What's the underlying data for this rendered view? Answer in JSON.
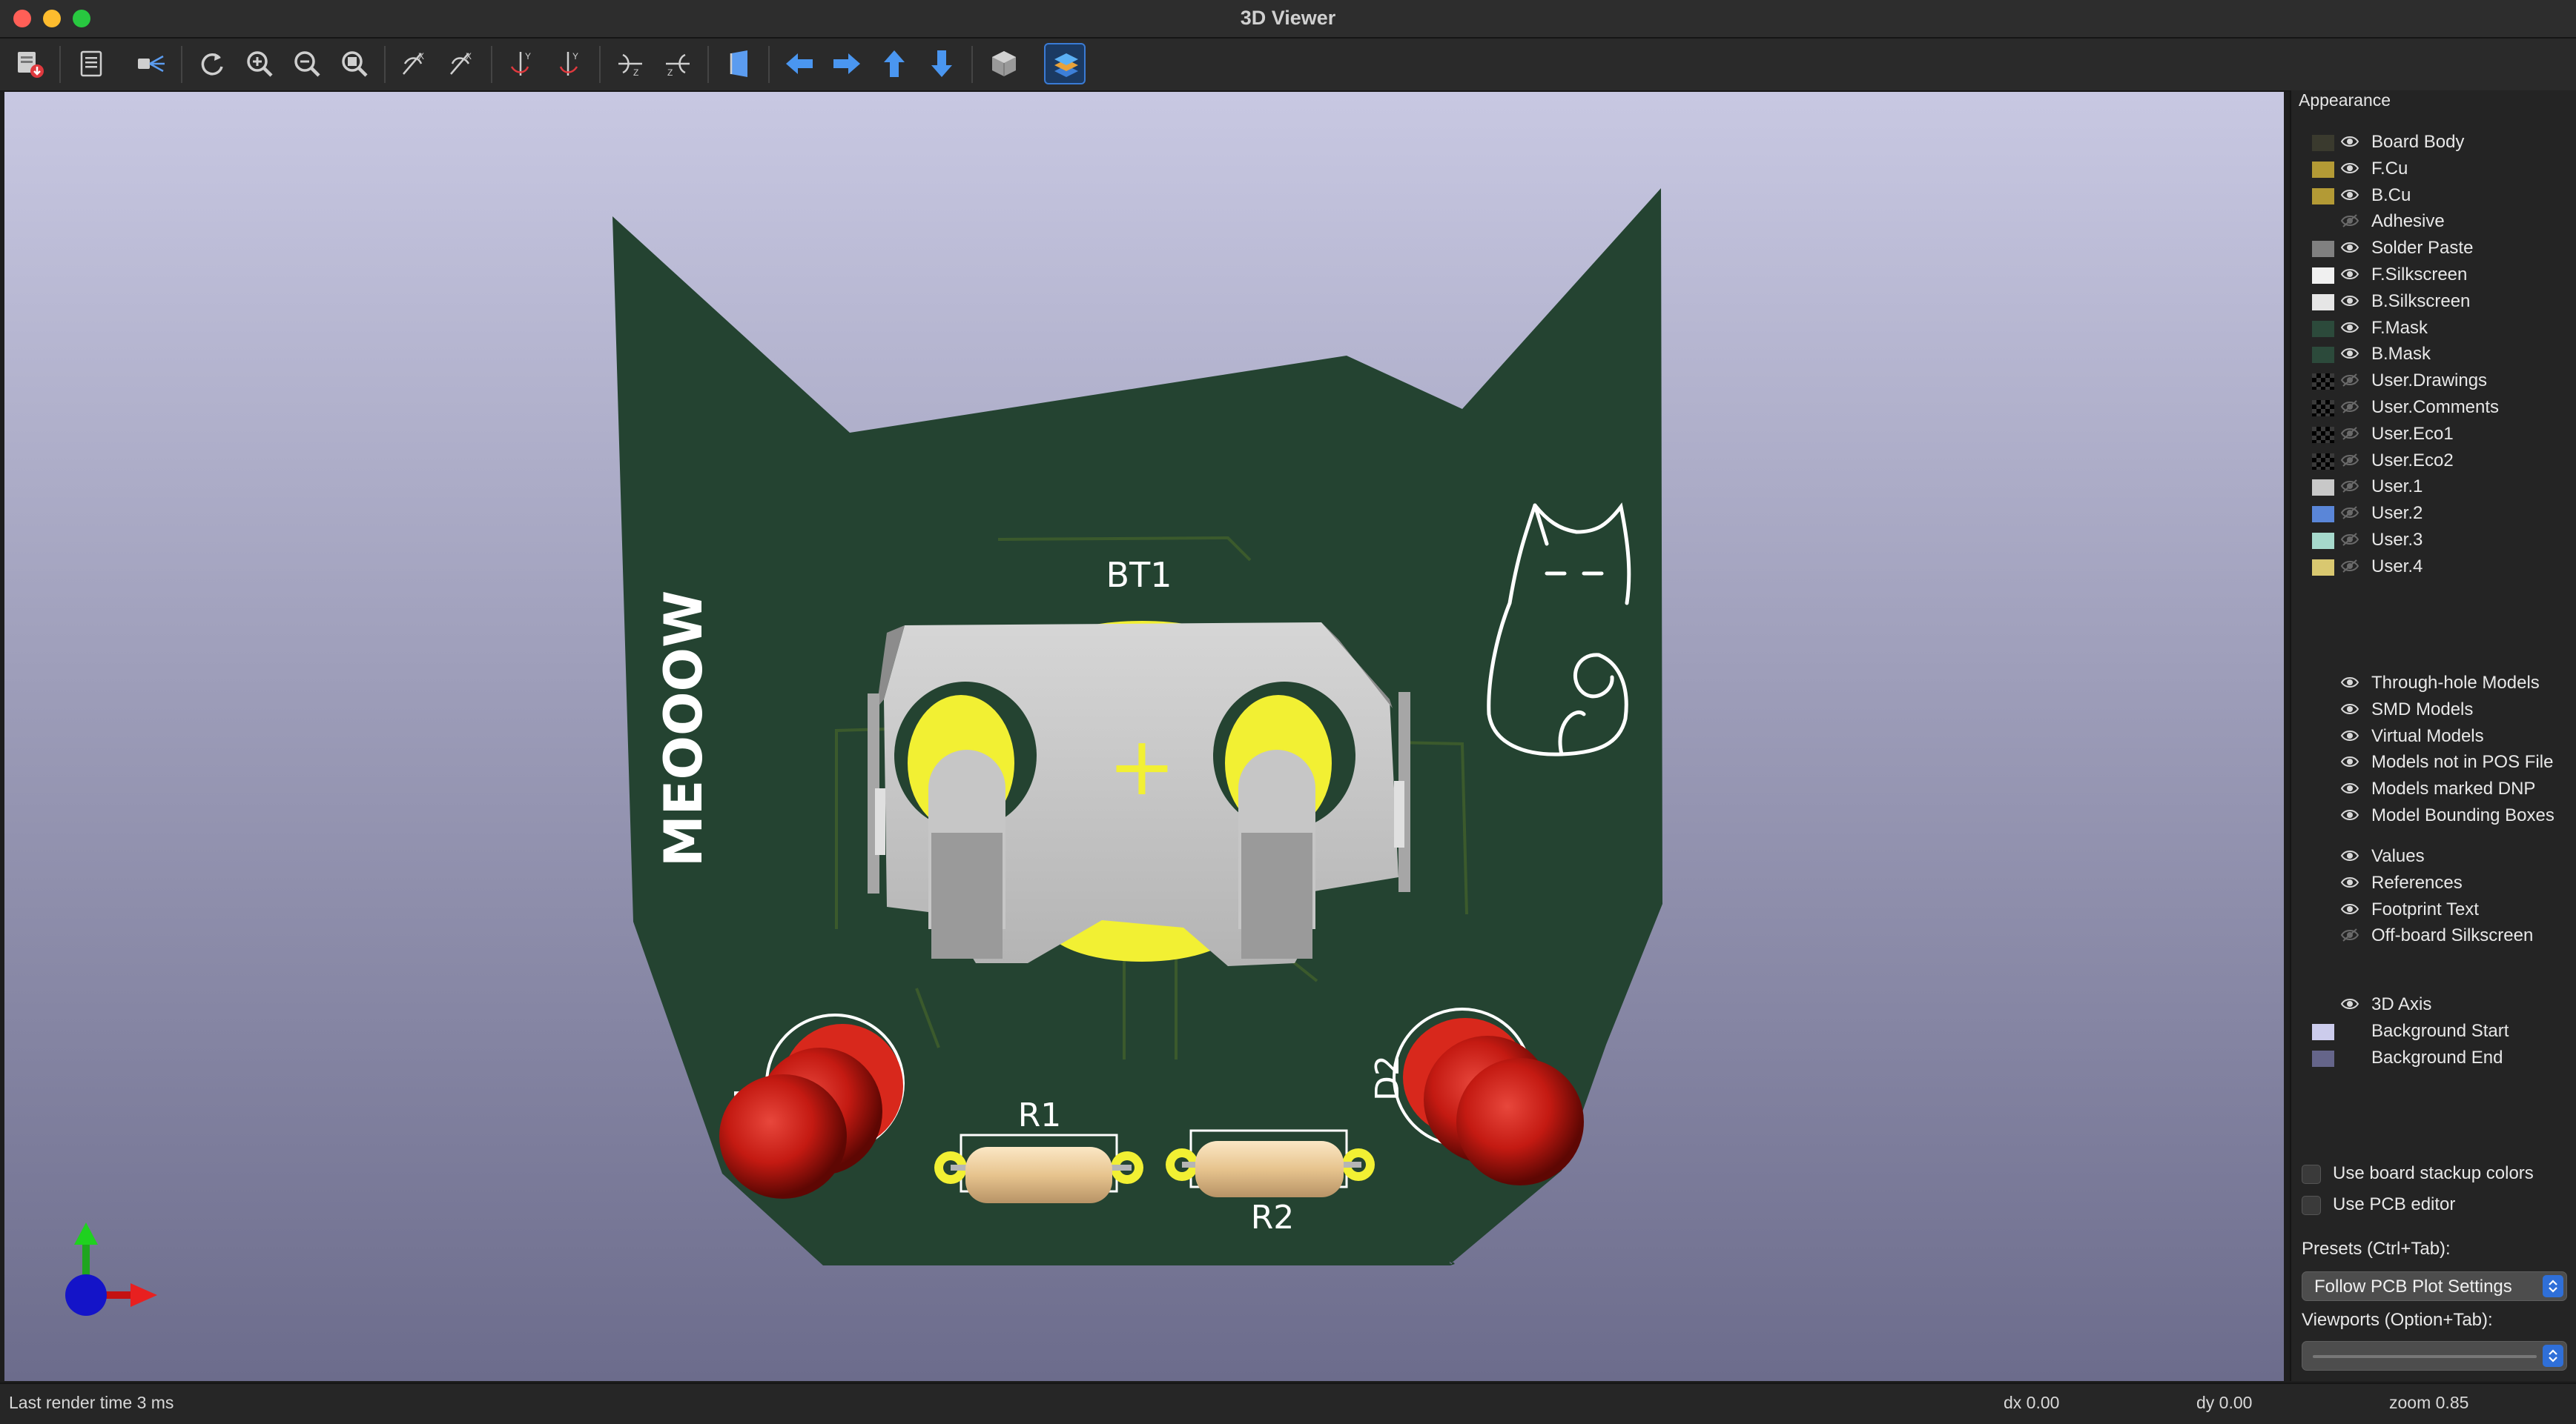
{
  "window": {
    "title": "3D Viewer"
  },
  "toolbar": {
    "buttons": [
      {
        "name": "export-image-button",
        "icon": "export-icon"
      },
      {
        "name": "copy-to-clipboard-button",
        "icon": "clipboard-icon"
      },
      {
        "name": "raytracing-button",
        "icon": "camera-rays-icon"
      },
      {
        "name": "reload-board-button",
        "icon": "refresh-icon"
      },
      {
        "name": "zoom-in-button",
        "icon": "zoom-in-icon"
      },
      {
        "name": "zoom-out-button",
        "icon": "zoom-out-icon"
      },
      {
        "name": "zoom-fit-button",
        "icon": "zoom-fit-icon"
      },
      {
        "name": "rotate-x-cw-button",
        "icon": "rotate-x-cw-icon"
      },
      {
        "name": "rotate-x-ccw-button",
        "icon": "rotate-x-ccw-icon"
      },
      {
        "name": "rotate-y-cw-button",
        "icon": "rotate-y-cw-icon"
      },
      {
        "name": "rotate-y-ccw-button",
        "icon": "rotate-y-ccw-icon"
      },
      {
        "name": "rotate-z-cw-button",
        "icon": "rotate-z-cw-icon"
      },
      {
        "name": "rotate-z-ccw-button",
        "icon": "rotate-z-ccw-icon"
      },
      {
        "name": "flip-board-button",
        "icon": "flip-board-icon"
      },
      {
        "name": "move-left-button",
        "icon": "arrow-left-icon"
      },
      {
        "name": "move-right-button",
        "icon": "arrow-right-icon"
      },
      {
        "name": "move-up-button",
        "icon": "arrow-up-icon"
      },
      {
        "name": "move-down-button",
        "icon": "arrow-down-icon"
      },
      {
        "name": "orthographic-toggle-button",
        "icon": "cube-icon"
      },
      {
        "name": "layers-manager-toggle-button",
        "icon": "layers-icon",
        "active": true
      }
    ]
  },
  "board": {
    "silk_text": "MEOOOW",
    "ref_bt1": "BT1",
    "ref_r1": "R1",
    "ref_r2": "R2",
    "ref_d2": "D2",
    "ref_d1_partial": "1",
    "plus_sign": "+",
    "colors": {
      "soldermask": "#244331",
      "copper": "#f2f033",
      "silkscreen": "#ffffff",
      "holder": "#c6c6c6",
      "led": "#c41a12",
      "resistor": "#eccf9e"
    }
  },
  "appearance": {
    "title": "Appearance",
    "layers": [
      {
        "label": "Board Body",
        "color": "#3a3a2e",
        "visible": true
      },
      {
        "label": "F.Cu",
        "color": "#b39a35",
        "visible": true
      },
      {
        "label": "B.Cu",
        "color": "#b39a35",
        "visible": true
      },
      {
        "label": "Adhesive",
        "color": "",
        "visible": false
      },
      {
        "label": "Solder Paste",
        "color": "#808080",
        "visible": true
      },
      {
        "label": "F.Silkscreen",
        "color": "#f0f0f0",
        "visible": true
      },
      {
        "label": "B.Silkscreen",
        "color": "#e6e6e6",
        "visible": true
      },
      {
        "label": "F.Mask",
        "color": "#2c4a3b",
        "visible": true
      },
      {
        "label": "B.Mask",
        "color": "#2c4a3b",
        "visible": true
      },
      {
        "label": "User.Drawings",
        "color": "checker",
        "visible": false
      },
      {
        "label": "User.Comments",
        "color": "checker",
        "visible": false
      },
      {
        "label": "User.Eco1",
        "color": "checker",
        "visible": false
      },
      {
        "label": "User.Eco2",
        "color": "checker",
        "visible": false
      },
      {
        "label": "User.1",
        "color": "#c8c8c8",
        "visible": false
      },
      {
        "label": "User.2",
        "color": "#5a86d8",
        "visible": false
      },
      {
        "label": "User.3",
        "color": "#a6d9cc",
        "visible": false
      },
      {
        "label": "User.4",
        "color": "#d9c870",
        "visible": false
      }
    ],
    "models": [
      {
        "label": "Through-hole Models",
        "visible": true
      },
      {
        "label": "SMD Models",
        "visible": true
      },
      {
        "label": "Virtual Models",
        "visible": true
      },
      {
        "label": "Models not in POS File",
        "visible": true
      },
      {
        "label": "Models marked DNP",
        "visible": true
      },
      {
        "label": "Model Bounding Boxes",
        "visible": true
      }
    ],
    "text_items": [
      {
        "label": "Values",
        "visible": true
      },
      {
        "label": "References",
        "visible": true
      },
      {
        "label": "Footprint Text",
        "visible": true
      },
      {
        "label": "Off-board Silkscreen",
        "visible": false
      }
    ],
    "misc": [
      {
        "label": "3D Axis",
        "visible": true,
        "color": ""
      },
      {
        "label": "Background Start",
        "visible": null,
        "color": "#ccccec"
      },
      {
        "label": "Background End",
        "visible": null,
        "color": "#65658a"
      }
    ],
    "use_board_stackup_colors": "Use board stackup colors",
    "use_pcb_editor": "Use PCB editor",
    "presets_label": "Presets (Ctrl+Tab):",
    "presets_value": "Follow PCB Plot Settings",
    "viewports_label": "Viewports (Option+Tab):",
    "viewports_value": ""
  },
  "status": {
    "render_time": "Last render time 3 ms",
    "dx": "dx 0.00",
    "dy": "dy 0.00",
    "zoom": "zoom 0.85"
  }
}
